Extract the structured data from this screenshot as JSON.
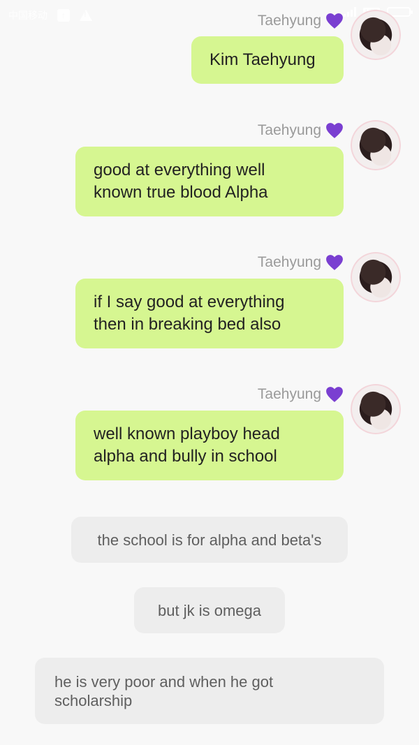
{
  "status_bar": {
    "carrier": "中国移动",
    "signal_label": "LTE"
  },
  "messages": [
    {
      "sender": "Taehyung",
      "text": "Kim Taehyung"
    },
    {
      "sender": "Taehyung",
      "text": "good at everything well known true blood Alpha"
    },
    {
      "sender": "Taehyung",
      "text": "if I say good at everything then in breaking bed also"
    },
    {
      "sender": "Taehyung",
      "text": "well known playboy head alpha and bully in school"
    }
  ],
  "narration": [
    "the school is for alpha and beta's",
    "but jk is omega",
    "he is very poor and when he got scholarship"
  ],
  "colors": {
    "background": "#f8f8f8",
    "sent_bubble": "#d6f691",
    "narration_bubble": "#ededed",
    "heart": "#7a3fd1",
    "name": "#9a9a9a"
  }
}
